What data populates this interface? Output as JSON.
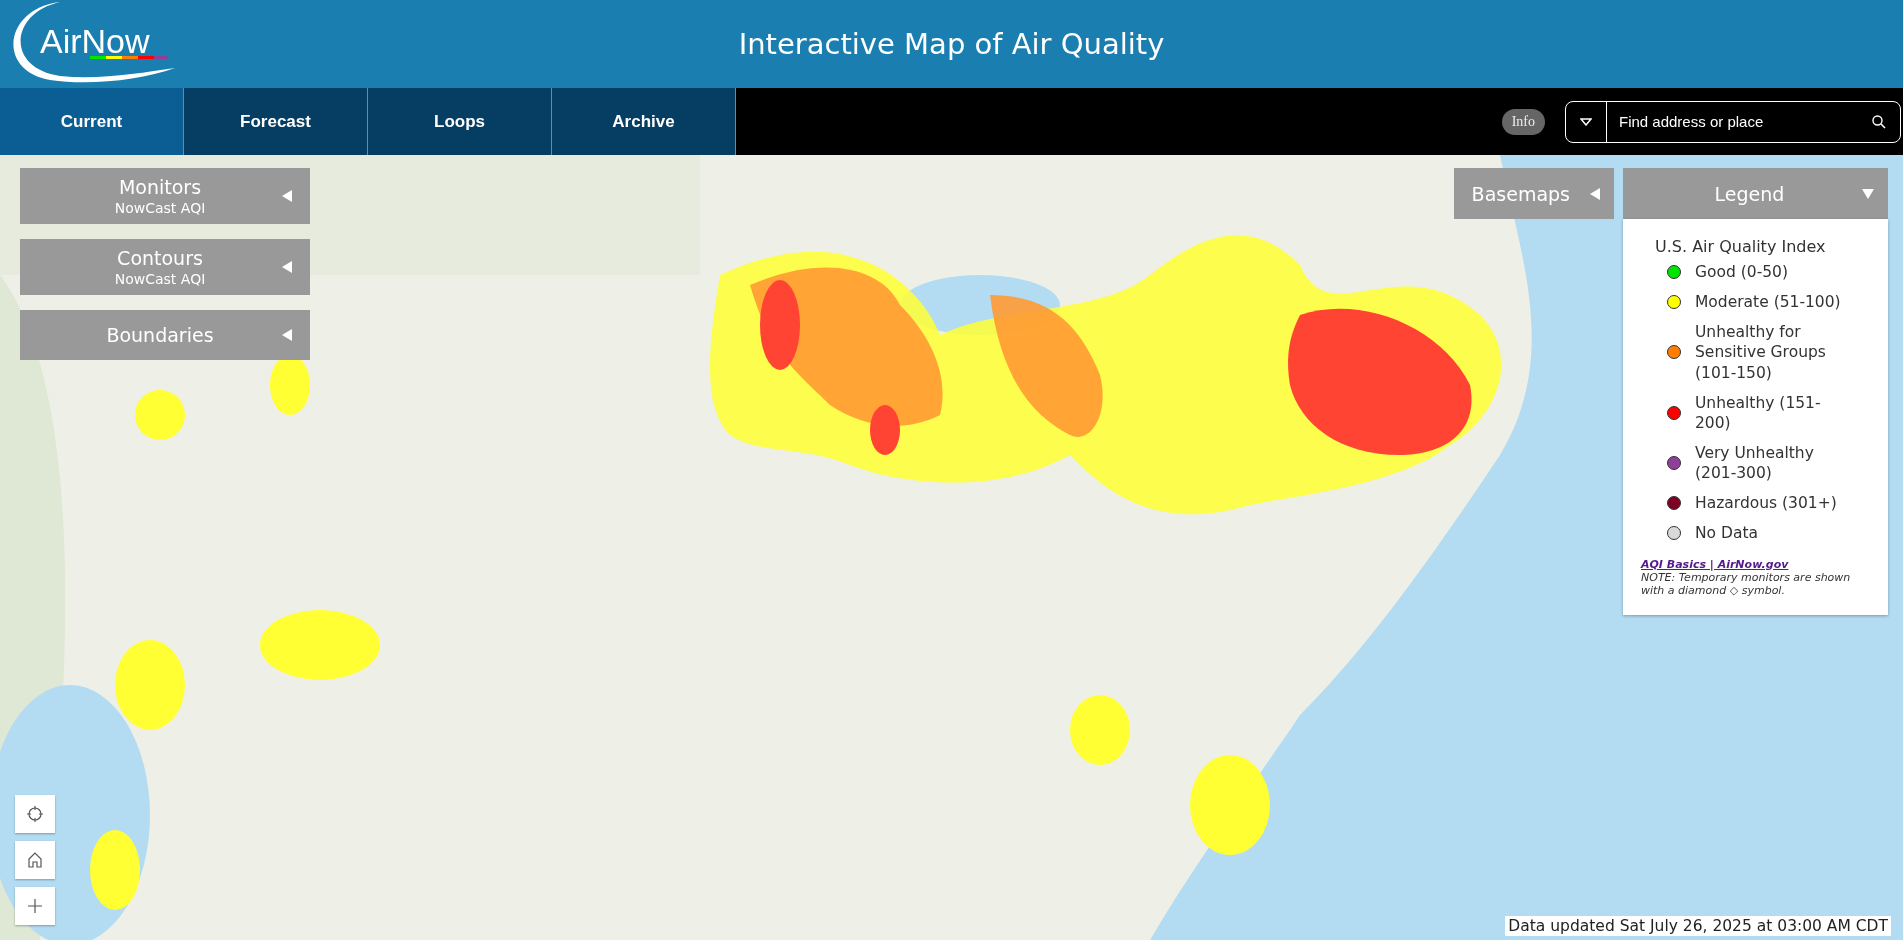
{
  "logo": {
    "text": "AirNow"
  },
  "title": "Interactive Map of Air Quality",
  "tabs": [
    {
      "label": "Current",
      "selected": true
    },
    {
      "label": "Forecast",
      "selected": false
    },
    {
      "label": "Loops",
      "selected": false
    },
    {
      "label": "Archive",
      "selected": false
    }
  ],
  "info_button": "Info",
  "search": {
    "placeholder": "Find address or place"
  },
  "layer_panels": [
    {
      "title": "Monitors",
      "subtitle": "NowCast AQI"
    },
    {
      "title": "Contours",
      "subtitle": "NowCast AQI"
    },
    {
      "title": "Boundaries"
    }
  ],
  "basemaps": {
    "title": "Basemaps"
  },
  "legend": {
    "title": "Legend",
    "heading": "U.S. Air Quality Index",
    "items": [
      {
        "label": "Good (0-50)",
        "color": "#00e400"
      },
      {
        "label": "Moderate (51-100)",
        "color": "#ffff00"
      },
      {
        "label": "Unhealthy for Sensitive Groups (101-150)",
        "color": "#ff7e00"
      },
      {
        "label": "Unhealthy (151-200)",
        "color": "#ff0000"
      },
      {
        "label": "Very Unhealthy (201-300)",
        "color": "#8f3f97"
      },
      {
        "label": "Hazardous (301+)",
        "color": "#7e0023"
      },
      {
        "label": "No Data",
        "color": "#d9d9d9"
      }
    ],
    "link": "AQI Basics | AirNow.gov",
    "note": "NOTE: Temporary monitors are shown with a diamond ◇ symbol."
  },
  "status": "Data updated Sat July 26, 2025 at 03:00 AM CDT"
}
